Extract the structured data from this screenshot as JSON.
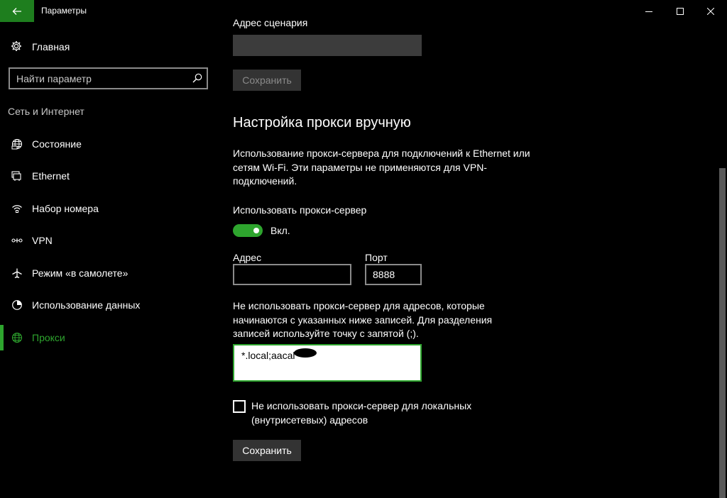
{
  "window": {
    "title": "Параметры",
    "back_icon": "arrow-left-icon",
    "accent": "#2ea52e"
  },
  "sidebar": {
    "home_label": "Главная",
    "search_placeholder": "Найти параметр",
    "section": "Сеть и Интернет",
    "items": [
      {
        "label": "Состояние",
        "icon": "globe-status-icon"
      },
      {
        "label": "Ethernet",
        "icon": "ethernet-icon"
      },
      {
        "label": "Набор номера",
        "icon": "dialup-icon"
      },
      {
        "label": "VPN",
        "icon": "vpn-icon"
      },
      {
        "label": "Режим «в самолете»",
        "icon": "airplane-icon"
      },
      {
        "label": "Использование данных",
        "icon": "data-usage-icon"
      },
      {
        "label": "Прокси",
        "icon": "globe-icon",
        "active": true
      }
    ]
  },
  "main": {
    "script_label": "Адрес сценария",
    "script_save": "Сохранить",
    "heading": "Настройка прокси вручную",
    "description": "Использование прокси-сервера для подключений к Ethernet или сетям Wi-Fi. Эти параметры не применяются для VPN-подключений.",
    "use_proxy_label": "Использовать прокси-сервер",
    "toggle_state": "Вкл.",
    "address_label": "Адрес",
    "address_value": "",
    "port_label": "Порт",
    "port_value": "8888",
    "exceptions_description": "Не использовать прокси-сервер для адресов, которые начинаются с указанных ниже записей. Для разделения записей используйте точку с запятой (;).",
    "exceptions_value": "*.local;aacal",
    "local_checkbox_label": "Не использовать прокси-сервер для локальных (внутрисетевых) адресов",
    "save_label": "Сохранить"
  }
}
